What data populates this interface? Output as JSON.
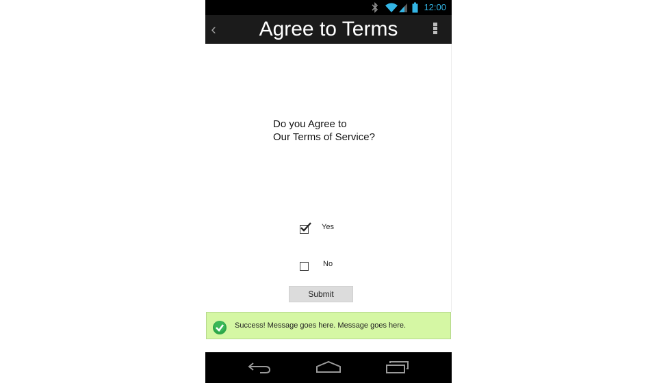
{
  "status_bar": {
    "time": "12:00",
    "icons": [
      "bluetooth-icon",
      "wifi-icon",
      "signal-icon",
      "battery-icon"
    ],
    "accent_color": "#33b5e5"
  },
  "action_bar": {
    "back_glyph": "‹",
    "title": "Agree to Terms",
    "overflow_icon": "overflow-menu-icon"
  },
  "question": {
    "line1": "Do you Agree to",
    "line2": "Our Terms of Service?"
  },
  "options": [
    {
      "label": "Yes",
      "checked": true
    },
    {
      "label": "No",
      "checked": false
    }
  ],
  "submit": {
    "label": "Submit"
  },
  "success": {
    "icon": "check-circle-icon",
    "message": "Success! Message goes here. Message goes here.",
    "background": "#d5f7a4"
  },
  "nav_bar": {
    "icons": [
      "back-icon",
      "home-icon",
      "recent-apps-icon"
    ]
  }
}
